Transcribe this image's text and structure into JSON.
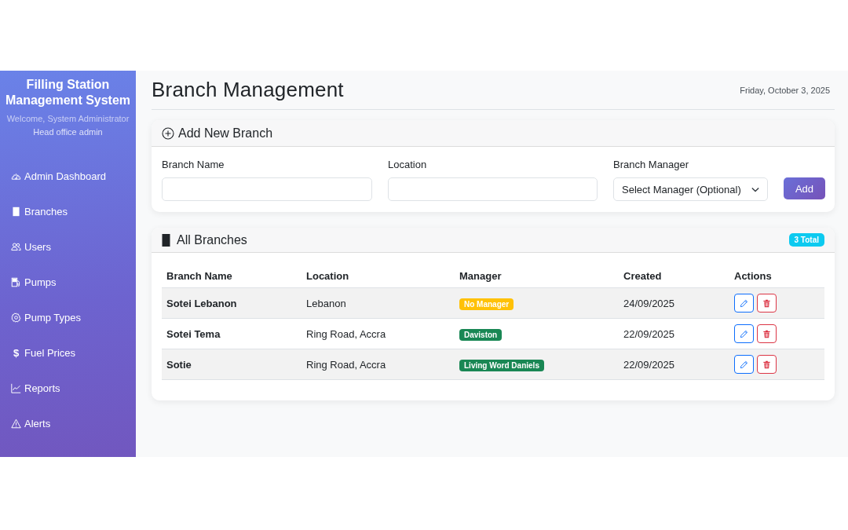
{
  "sidebar": {
    "title": "Filling Station Management System",
    "welcome": "Welcome, System Administrator",
    "role": "Head office admin",
    "items": [
      {
        "label": "Admin Dashboard"
      },
      {
        "label": "Branches"
      },
      {
        "label": "Users"
      },
      {
        "label": "Pumps"
      },
      {
        "label": "Pump Types"
      },
      {
        "label": "Fuel Prices",
        "glyph": "$"
      },
      {
        "label": "Reports"
      },
      {
        "label": "Alerts"
      }
    ]
  },
  "header": {
    "title": "Branch Management",
    "date": "Friday, October 3, 2025"
  },
  "add_form": {
    "title": "Add New Branch",
    "fields": [
      {
        "kind": "text",
        "label": "Branch Name"
      },
      {
        "kind": "text",
        "label": "Location"
      },
      {
        "kind": "select",
        "label": "Branch Manager",
        "value": "Select Manager (Optional)"
      }
    ],
    "submit": "Add"
  },
  "branches": {
    "title": "All Branches",
    "count": "3 Total",
    "columns": [
      "Branch Name",
      "Location",
      "Manager",
      "Created",
      "Actions"
    ],
    "rows": [
      {
        "name": "Sotei Lebanon",
        "location": "Lebanon",
        "manager": {
          "label": "No Manager",
          "color": "#ffc107"
        },
        "created": "24/09/2025"
      },
      {
        "name": "Sotei Tema",
        "location": "Ring Road, Accra",
        "manager": {
          "label": "Daviston",
          "color": "#198754"
        },
        "created": "22/09/2025"
      },
      {
        "name": "Sotie",
        "location": "Ring Road, Accra",
        "manager": {
          "label": "Living Word Daniels",
          "color": "#198754"
        },
        "created": "22/09/2025"
      }
    ]
  }
}
